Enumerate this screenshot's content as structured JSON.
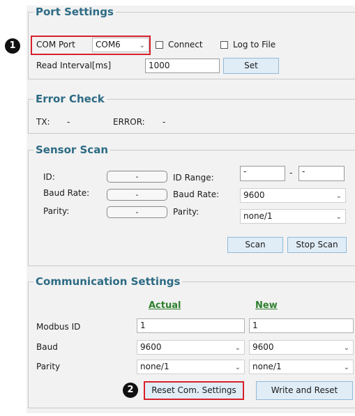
{
  "port_settings": {
    "title": "Port Settings",
    "com_port_label": "COM Port",
    "com_port_value": "COM6",
    "connect_label": "Connect",
    "log_label": "Log to File",
    "read_interval_label": "Read Interval[ms]",
    "read_interval_value": "1000",
    "set_label": "Set"
  },
  "error_check": {
    "title": "Error Check",
    "tx_label": "TX:",
    "tx_value": "-",
    "error_label": "ERROR:",
    "error_value": "-"
  },
  "sensor_scan": {
    "title": "Sensor Scan",
    "id_label": "ID:",
    "id_value": "-",
    "baud_label": "Baud Rate:",
    "baud_value": "-",
    "parity_label": "Parity:",
    "parity_value": "-",
    "id_range_label": "ID Range:",
    "id_range_from": "-",
    "id_range_sep": "-",
    "id_range_to": "-",
    "baud_rate_label": "Baud Rate:",
    "baud_rate_select": "9600",
    "parity_select_label": "Parity:",
    "parity_select": "none/1",
    "scan_label": "Scan",
    "stop_scan_label": "Stop Scan"
  },
  "comm_settings": {
    "title": "Communication Settings",
    "actual_header": "Actual",
    "new_header": "New",
    "modbus_label": "Modbus ID",
    "modbus_actual": "1",
    "modbus_new": "1",
    "baud_label": "Baud",
    "baud_actual": "9600",
    "baud_new": "9600",
    "parity_label": "Parity",
    "parity_actual": "none/1",
    "parity_new": "none/1",
    "reset_label": "Reset Com. Settings",
    "write_reset_label": "Write and Reset"
  },
  "callouts": {
    "one": "1",
    "two": "2"
  }
}
